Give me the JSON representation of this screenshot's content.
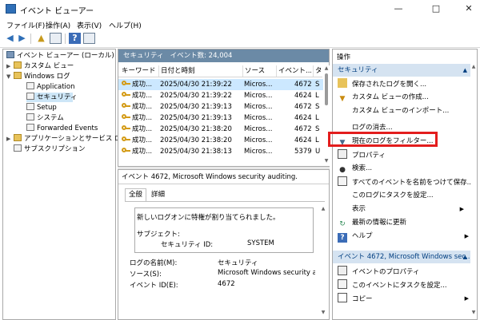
{
  "window": {
    "title": "イベント ビューアー",
    "controls": [
      "minimize",
      "maximize",
      "close"
    ]
  },
  "menu": [
    "ファイル(F)",
    "操作(A)",
    "表示(V)",
    "ヘルプ(H)"
  ],
  "tree": {
    "root": "イベント ビューアー (ローカル)",
    "items": [
      {
        "label": "カスタム ビュー",
        "level": 1,
        "icon": "folder-icon"
      },
      {
        "label": "Windows ログ",
        "level": 1,
        "icon": "folder-icon",
        "expanded": true
      },
      {
        "label": "Application",
        "level": 2,
        "icon": "log-icon"
      },
      {
        "label": "セキュリティ",
        "level": 2,
        "icon": "log-icon",
        "selected": true
      },
      {
        "label": "Setup",
        "level": 2,
        "icon": "log-icon"
      },
      {
        "label": "システム",
        "level": 2,
        "icon": "log-icon"
      },
      {
        "label": "Forwarded Events",
        "level": 2,
        "icon": "log-icon"
      },
      {
        "label": "アプリケーションとサービス ログ",
        "level": 1,
        "icon": "folder-icon"
      },
      {
        "label": "サブスクリプション",
        "level": 1,
        "icon": "log-icon"
      }
    ]
  },
  "log": {
    "header_name": "セキュリティ",
    "header_count": "イベント数: 24,004",
    "columns": [
      "キーワード",
      "日付と時刻",
      "ソース",
      "イベント...",
      "タ"
    ],
    "rows": [
      {
        "keyword": "成功...",
        "datetime": "2025/04/30 21:39:22",
        "source": "Micros...",
        "event_id": "4672",
        "task": "S"
      },
      {
        "keyword": "成功...",
        "datetime": "2025/04/30 21:39:22",
        "source": "Micros...",
        "event_id": "4624",
        "task": "L"
      },
      {
        "keyword": "成功...",
        "datetime": "2025/04/30 21:39:13",
        "source": "Micros...",
        "event_id": "4672",
        "task": "S"
      },
      {
        "keyword": "成功...",
        "datetime": "2025/04/30 21:39:13",
        "source": "Micros...",
        "event_id": "4624",
        "task": "L"
      },
      {
        "keyword": "成功...",
        "datetime": "2025/04/30 21:38:20",
        "source": "Micros...",
        "event_id": "4672",
        "task": "S"
      },
      {
        "keyword": "成功...",
        "datetime": "2025/04/30 21:38:20",
        "source": "Micros...",
        "event_id": "4624",
        "task": "L"
      },
      {
        "keyword": "成功...",
        "datetime": "2025/04/30 21:38:13",
        "source": "Micros...",
        "event_id": "5379",
        "task": "U"
      }
    ]
  },
  "detail": {
    "title": "イベント 4672, Microsoft Windows security auditing.",
    "tabs": [
      "全般",
      "詳細"
    ],
    "message": "新しいログオンに特権が割り当てられました。",
    "subject_label": "サブジェクト:",
    "security_id_label": "セキュリティ ID:",
    "security_id_value": "SYSTEM",
    "fields": [
      {
        "label": "ログの名前(M):",
        "value": "セキュリティ"
      },
      {
        "label": "ソース(S):",
        "value": "Microsoft Windows security a"
      },
      {
        "label": "イベント ID(E):",
        "value": "4672"
      }
    ]
  },
  "actions": {
    "title": "操作",
    "section1": "セキュリティ",
    "items1": [
      {
        "label": "保存されたログを開く...",
        "icon": "open-log-icon"
      },
      {
        "label": "カスタム ビューの作成...",
        "icon": "filter-icon"
      },
      {
        "label": "カスタム ビューのインポート...",
        "icon": "none"
      },
      {
        "label": "ログの消去...",
        "icon": "none"
      },
      {
        "label": "現在のログをフィルター...",
        "icon": "filter-icon",
        "highlight": true
      },
      {
        "label": "プロパティ",
        "icon": "properties-icon"
      },
      {
        "label": "検索...",
        "icon": "binoculars-icon"
      },
      {
        "label": "すべてのイベントを名前をつけて保存...",
        "icon": "save-icon"
      },
      {
        "label": "このログにタスクを設定...",
        "icon": "none"
      },
      {
        "label": "表示",
        "icon": "none",
        "submenu": true
      },
      {
        "label": "最新の情報に更新",
        "icon": "refresh-icon"
      },
      {
        "label": "ヘルプ",
        "icon": "help-icon",
        "submenu": true
      }
    ],
    "section2": "イベント 4672, Microsoft Windows sec...",
    "items2": [
      {
        "label": "イベントのプロパティ",
        "icon": "event-properties-icon"
      },
      {
        "label": "このイベントにタスクを設定...",
        "icon": "task-icon"
      },
      {
        "label": "コピー",
        "icon": "copy-icon",
        "submenu": true
      }
    ]
  },
  "colors": {
    "accent": "#e31d1d",
    "header": "#6b8aa6",
    "action_header": "#d5e3f1",
    "selection": "#cce8ff"
  }
}
